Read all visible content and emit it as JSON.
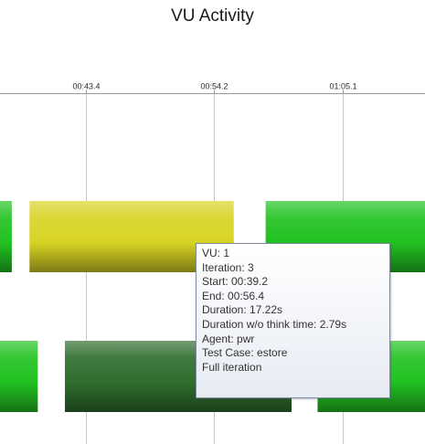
{
  "chart_data": {
    "type": "gantt",
    "title": "VU Activity",
    "x_ticks": [
      "00:43.4",
      "00:54.2",
      "01:05.1"
    ],
    "x_tick_seconds": [
      43.4,
      54.2,
      65.1
    ],
    "xlim_seconds": [
      36.1,
      72.1
    ],
    "grid": true,
    "lanes": [
      {
        "bars": [
          {
            "start_seconds": 34.0,
            "end_seconds": 37.1,
            "color": "#22c222"
          },
          {
            "start_seconds": 38.6,
            "end_seconds": 55.9,
            "color": "#d8d425"
          },
          {
            "start_seconds": 58.6,
            "end_seconds": 75.0,
            "color": "#22c222"
          }
        ]
      },
      {
        "bars": [
          {
            "start_seconds": 34.0,
            "end_seconds": 39.3,
            "color": "#22c222"
          },
          {
            "start_seconds": 41.6,
            "end_seconds": 60.8,
            "color": "#2f6e2f"
          },
          {
            "start_seconds": 63.0,
            "end_seconds": 75.0,
            "color": "#22c222"
          }
        ]
      }
    ],
    "tooltip": {
      "lines": [
        "VU: 1",
        "Iteration: 3",
        "Start: 00:39.2",
        "End: 00:56.4",
        "Duration: 17.22s",
        "Duration w/o think time: 2.79s",
        "Agent: pwr",
        "Test Case: estore",
        "Full iteration"
      ]
    }
  },
  "colors": {
    "axis_line": "#9a9a9a",
    "grid_line": "#c6c6c6",
    "tooltip_border": "#7f8a9a"
  }
}
